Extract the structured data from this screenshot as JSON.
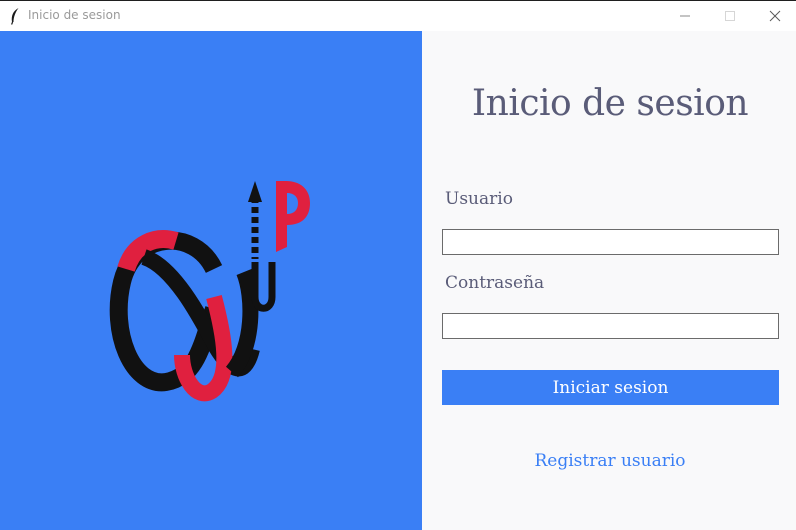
{
  "window": {
    "title": "Inicio de sesion",
    "icon": "feather-icon"
  },
  "logo": {
    "description_icon": "infinity-up-logo",
    "letter": "P",
    "colors": {
      "background": "#3a7ff5",
      "dark": "#111111",
      "accent": "#e0203f"
    }
  },
  "form": {
    "title": "Inicio de sesion",
    "username_label": "Usuario",
    "username_value": "",
    "password_label": "Contraseña",
    "password_value": "",
    "submit_label": "Iniciar sesion",
    "register_link": "Registrar usuario"
  },
  "colors": {
    "accent": "#3a7ff5",
    "form_background": "#f9f9fa",
    "heading_text": "#5a5c78"
  }
}
